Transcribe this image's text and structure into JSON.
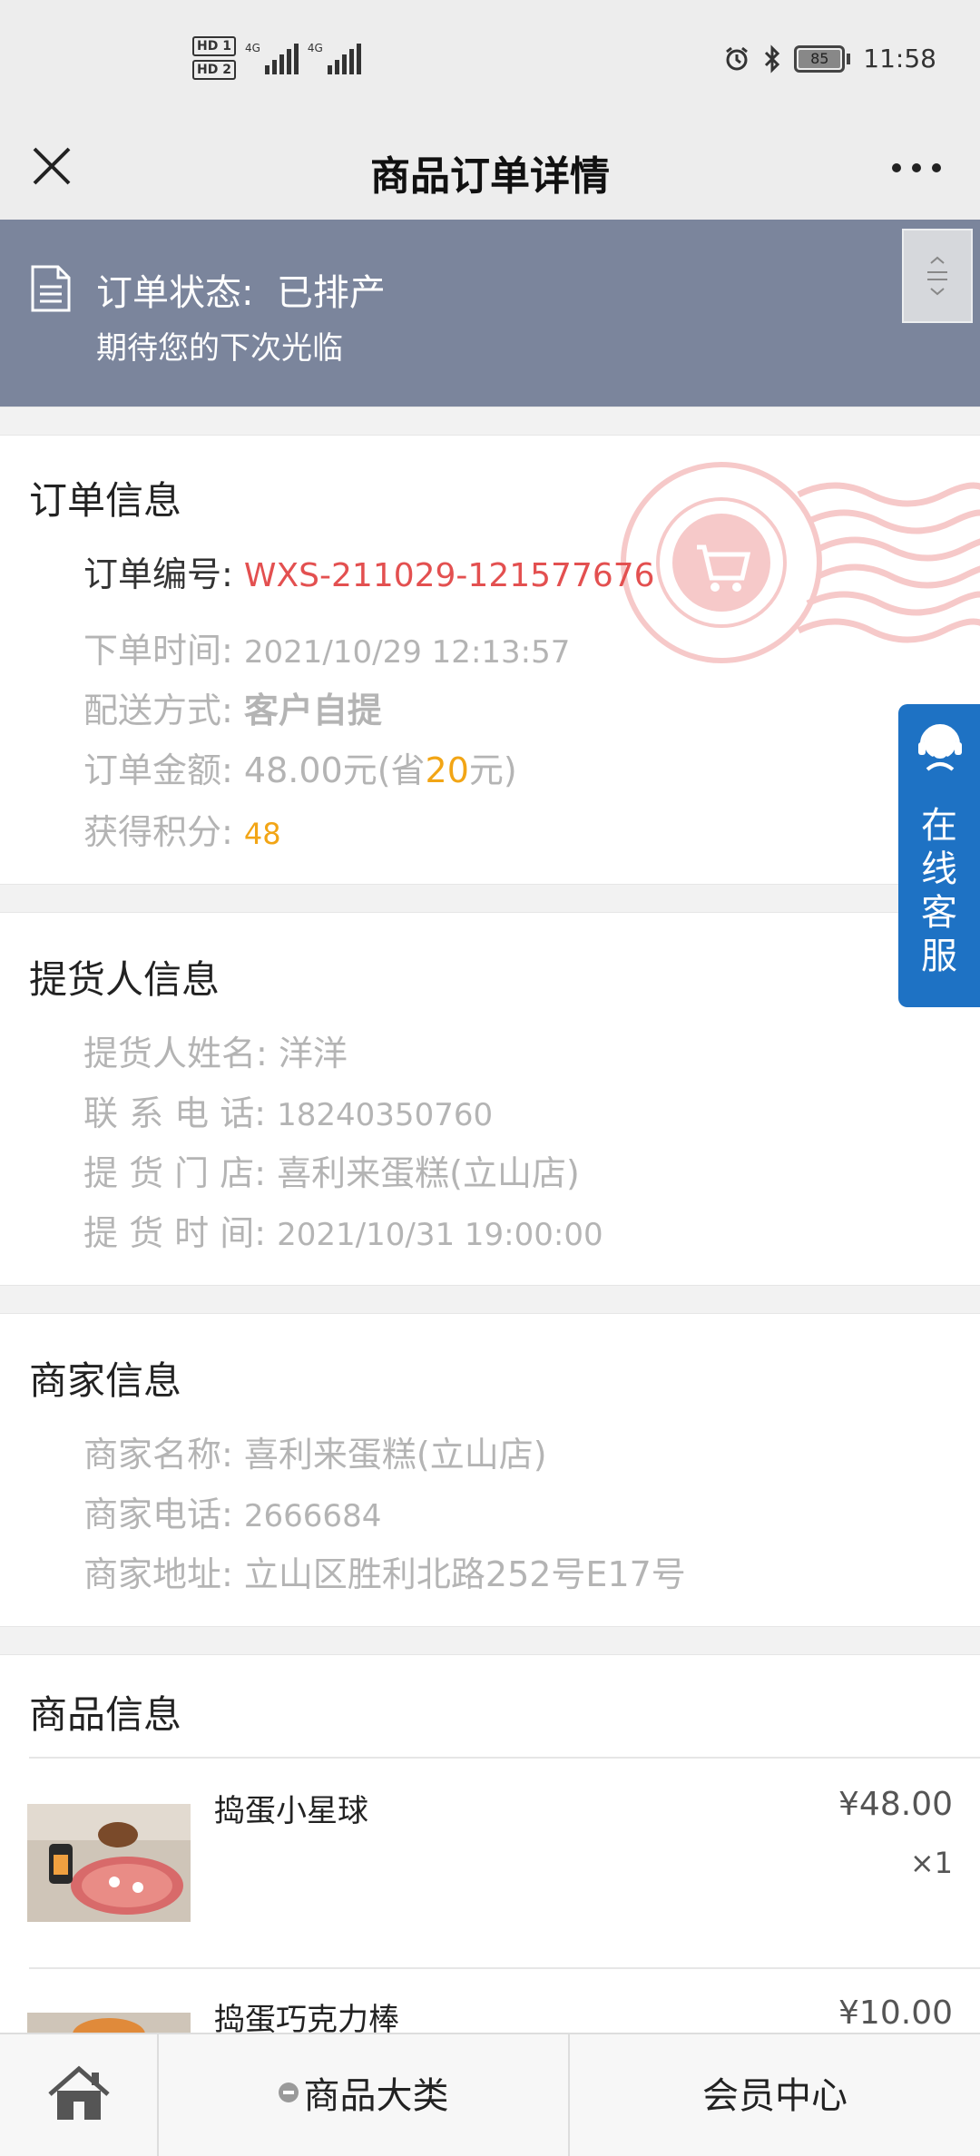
{
  "status_bar": {
    "time": "11:58",
    "battery": "85",
    "hd1": "HD 1",
    "hd2": "HD 2",
    "net": "4G"
  },
  "nav": {
    "title": "商品订单详情"
  },
  "order_status": {
    "label": "订单状态:",
    "value": "已排产",
    "subtitle": "期待您的下次光临"
  },
  "order_info": {
    "title": "订单信息",
    "number_label": "订单编号:",
    "number": "WXS-211029-121577676",
    "time_label": "下单时间:",
    "time": "2021/10/29 12:13:57",
    "delivery_label": "配送方式:",
    "delivery": "客户自提",
    "amount_label": "订单金额:",
    "amount_prefix": "48.00元(省",
    "amount_saved": "20",
    "amount_suffix": "元)",
    "points_label": "获得积分:",
    "points": "48"
  },
  "pickup_info": {
    "title": "提货人信息",
    "name_label": "提货人姓名:",
    "name": "洋洋",
    "phone_label": "联 系 电 话:",
    "phone": "18240350760",
    "store_label": "提 货 门 店:",
    "store": "喜利来蛋糕(立山店)",
    "time_label": "提 货 时 间:",
    "time": "2021/10/31 19:00:00"
  },
  "merchant_info": {
    "title": "商家信息",
    "name_label": "商家名称:",
    "name": "喜利来蛋糕(立山店)",
    "phone_label": "商家电话:",
    "phone": "2666684",
    "address_label": "商家地址:",
    "address": "立山区胜利北路252号E17号"
  },
  "products": {
    "title": "商品信息",
    "items": [
      {
        "name": "捣蛋小星球",
        "price": "¥48.00",
        "qty": "×1"
      },
      {
        "name": "捣蛋巧克力棒",
        "price": "¥10.00"
      }
    ]
  },
  "service": {
    "label": "在线客服"
  },
  "tabbar": {
    "category": "商品大类",
    "member": "会员中心"
  },
  "colors": {
    "banner": "#7b859c",
    "order_number": "#e35050",
    "accent_orange": "#f2a515",
    "service_blue": "#1e72c4"
  }
}
